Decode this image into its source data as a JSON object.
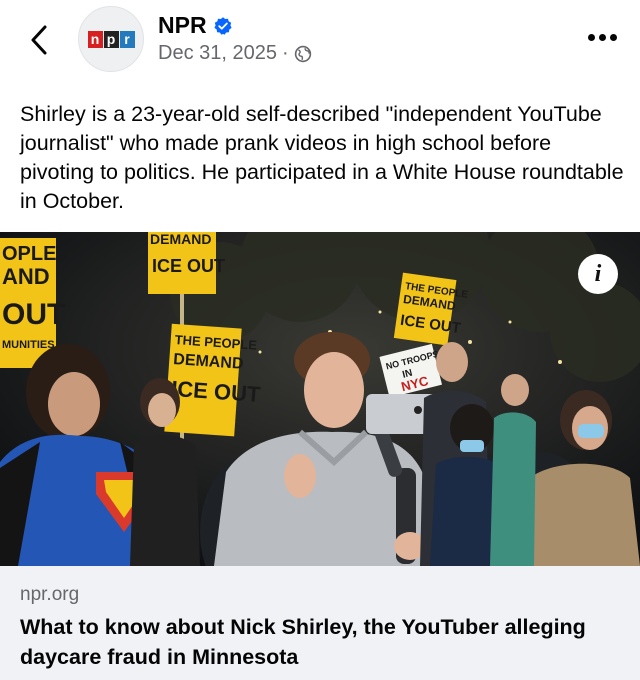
{
  "header": {
    "page_name": "NPR",
    "date": "Dec 31, 2025",
    "separator": "·",
    "avatar_logo_letters": [
      "n",
      "p",
      "r"
    ],
    "icons": {
      "back": "chevron-left-icon",
      "verified": "verified-badge-icon",
      "audience": "globe-icon",
      "more": "more-horizontal-icon"
    }
  },
  "post": {
    "text": "Shirley is a 23-year-old self-described \"independent YouTube journalist\" who made prank videos in high school before pivoting to politics. He participated in a White House roundtable in October."
  },
  "photo": {
    "info_label": "i",
    "signs": {
      "sign_left": [
        "OPLE",
        "AND",
        "OUT",
        "MUNITIES"
      ],
      "sign_top": [
        "DEMAND",
        "ICE OUT"
      ],
      "sign_center": [
        "THE PEOPLE",
        "DEMAND",
        "ICE OUT"
      ],
      "sign_right": [
        "THE PEOPLE",
        "DEMAND",
        "ICE OUT"
      ],
      "sign_troops": [
        "NO TROOPS",
        "IN",
        "NYC"
      ]
    }
  },
  "link_card": {
    "domain": "npr.org",
    "headline": "What to know about Nick Shirley, the YouTuber alleging daycare fraud in Minnesota"
  },
  "colors": {
    "verified_blue": "#0866ff",
    "meta_gray": "#65676b",
    "card_bg": "#f0f2f5",
    "sign_yellow": "#f2c418"
  }
}
